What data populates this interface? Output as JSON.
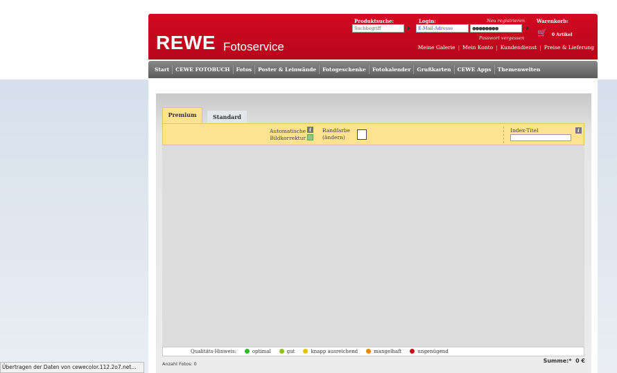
{
  "header": {
    "logo": "REWE",
    "logo_sub": "Fotoservice",
    "search_label": "Produktsuche:",
    "search_placeholder": "Suchbegriff",
    "login_label": "Login:",
    "register": "Neu registrieren",
    "email_placeholder": "E-Mail-Adresse",
    "password_value": "●●●●●●●●",
    "forgot": "Passwort vergessen",
    "cart_label": "Warenkorb:",
    "cart_count": "0 Artikel",
    "links": [
      "Meine Galerie",
      "Mein Konto",
      "Kundendienst",
      "Preise & Lieferung"
    ]
  },
  "nav": [
    "Start",
    "CEWE FOTOBUCH",
    "Fotos",
    "Poster & Leinwände",
    "Fotogeschenke",
    "Fotokalender",
    "Grußkarten",
    "CEWE Apps",
    "Themenwelten"
  ],
  "tabs": {
    "premium": "Premium",
    "standard": "Standard"
  },
  "options": {
    "auto1": "Automatische",
    "auto2": "Bildkorrektur",
    "rand": "Randfarbe",
    "aendern": "(ändern)",
    "index": "Index-Titel",
    "info": "i"
  },
  "legend": {
    "label": "Qualitäts-Hinweis:",
    "items": [
      {
        "text": "optimal",
        "color": "#2db82d"
      },
      {
        "text": "gut",
        "color": "#8cc21a"
      },
      {
        "text": "knapp ausreichend",
        "color": "#e6c200"
      },
      {
        "text": "mangelhaft",
        "color": "#e88a00"
      },
      {
        "text": "ungenügend",
        "color": "#cc0a1e"
      }
    ]
  },
  "footer": {
    "count_label": "Anzahl Fotos:",
    "count": "0",
    "sum_label": "Summe:*",
    "sum": "0 €"
  },
  "status": "Übertragen der Daten von cewecolor.112.2o7.net..."
}
